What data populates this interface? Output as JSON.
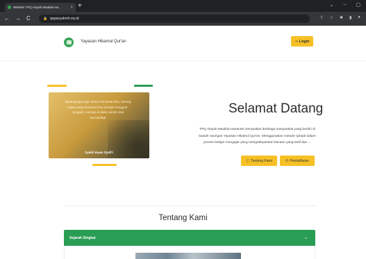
{
  "browser": {
    "tab_title": "Website TPQ Aisyah Maulida Ha...",
    "tab_close": "×",
    "new_tab": "+",
    "url": "tpqaisyahmh.my.id",
    "controls": {
      "minimize": "–",
      "maximize": "▢",
      "close": "✕"
    }
  },
  "header": {
    "brand": "Yayasan Hikamul Qur'an",
    "login_label": "Login"
  },
  "hero": {
    "image_quote": "Barangsiapa ingin dunia mencintai ilmu, barang siapa yang menuntut ilmu dengan sungguh-sungguh, niscaya ia akan sukses dan bermanfaat",
    "image_author": "Syekh Imam Syafi'i",
    "title": "Selamat Datang",
    "description": "TPQ Aisyah Maulida Hasanah merupakan lembaga masyarakat yang berdiri di bawah naungan Yayasan Hikamul Qur'an. Menggunakan metode Qiraati dalam proses belajar mengajar yang mengedepankan bacaan yang tartil dan ...",
    "btn_about": "Tentang Kami",
    "btn_register": "Pendaftaran"
  },
  "about": {
    "title": "Tentang Kami",
    "accordion_label": "Sejarah Singkat"
  },
  "colors": {
    "accent_yellow": "#f6c026",
    "accent_green": "#2a9d55"
  },
  "icons": {
    "login": "login-icon",
    "about": "info-icon",
    "register": "whatsapp-icon",
    "accordion": "chevron-down-icon"
  }
}
